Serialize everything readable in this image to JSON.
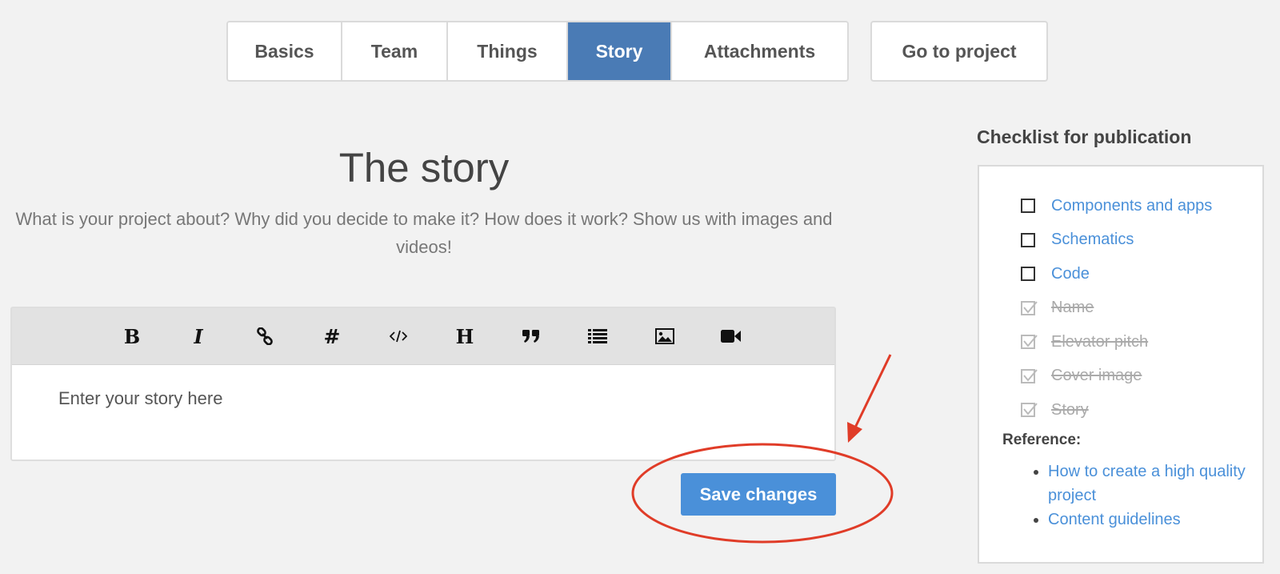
{
  "tabs": [
    {
      "label": "Basics",
      "active": false
    },
    {
      "label": "Team",
      "active": false
    },
    {
      "label": "Things",
      "active": false
    },
    {
      "label": "Story",
      "active": true
    },
    {
      "label": "Attachments",
      "active": false
    }
  ],
  "goto_label": "Go to project",
  "story": {
    "title": "The story",
    "subtitle": "What is your project about? Why did you decide to make it? How does it work? Show us with images and videos!"
  },
  "editor": {
    "toolbar": [
      "bold-icon",
      "italic-icon",
      "link-icon",
      "hashtag-icon",
      "code-icon",
      "heading-icon",
      "quote-icon",
      "list-icon",
      "image-icon",
      "video-icon"
    ],
    "placeholder": "Enter your story here"
  },
  "save_label": "Save changes",
  "checklist": {
    "title": "Checklist for publication",
    "items": [
      {
        "label": "Components and apps",
        "done": false
      },
      {
        "label": "Schematics",
        "done": false
      },
      {
        "label": "Code",
        "done": false
      },
      {
        "label": "Name",
        "done": true
      },
      {
        "label": "Elevator pitch",
        "done": true
      },
      {
        "label": "Cover image",
        "done": true
      },
      {
        "label": "Story",
        "done": true
      }
    ],
    "reference_title": "Reference:",
    "references": [
      "How to create a high quality project",
      "Content guidelines"
    ]
  },
  "colors": {
    "active_tab": "#4a7bb5",
    "primary_button": "#4a90d9",
    "link": "#4a90d9",
    "annotation": "#e03c28"
  }
}
